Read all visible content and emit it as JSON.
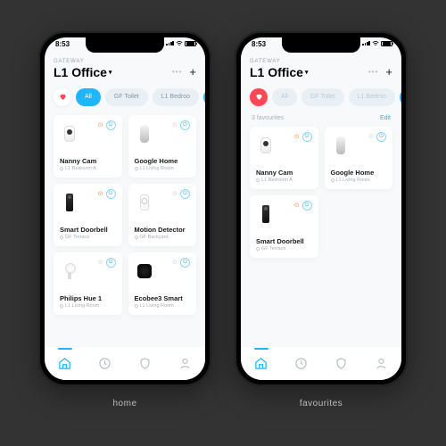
{
  "status": {
    "time": "8:53"
  },
  "header": {
    "eyebrow": "GATEWAY",
    "title": "L1 Office"
  },
  "chips": [
    {
      "label": "All",
      "active": true
    },
    {
      "label": "GF Toilet",
      "active": false
    },
    {
      "label": "L1 Bedroo",
      "active": false
    }
  ],
  "devices": [
    {
      "name": "Nanny Cam",
      "room": "L1 Bedroom A",
      "accent": true
    },
    {
      "name": "Google Home",
      "room": "L1 Living Room",
      "accent": false
    },
    {
      "name": "Smart Doorbell",
      "room": "GF Terrace",
      "accent": true
    },
    {
      "name": "Motion Detector",
      "room": "GF Backyard",
      "accent": false
    },
    {
      "name": "Philips Hue 1",
      "room": "L1 Living Room",
      "accent": false
    },
    {
      "name": "Ecobee3 Smart",
      "room": "L1 Living Room",
      "accent": false
    }
  ],
  "fav": {
    "count_label": "3 favourites",
    "edit_label": "Edit"
  },
  "captions": {
    "left": "home",
    "right": "favourites"
  }
}
